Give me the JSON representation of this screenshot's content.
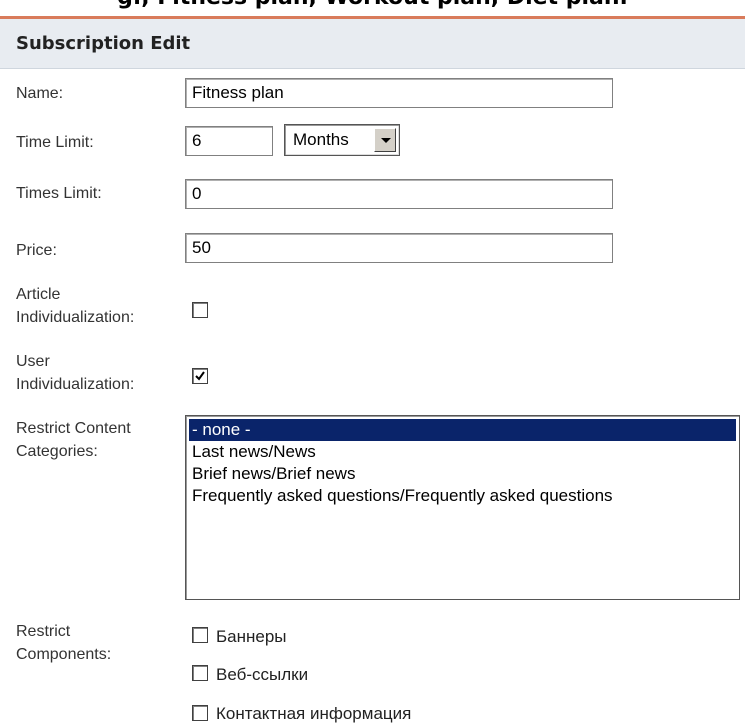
{
  "top_heading": "g., Fitness plan, Workout plan, Diet plan.",
  "panel": {
    "title": "Subscription Edit"
  },
  "form": {
    "name": {
      "label": "Name:",
      "value": "Fitness plan"
    },
    "time_limit": {
      "label": "Time Limit:",
      "value": "6",
      "unit_selected": "Months"
    },
    "times_limit": {
      "label": "Times Limit:",
      "value": "0"
    },
    "price": {
      "label": "Price:",
      "value": "50"
    },
    "article_individualization": {
      "label_line1": "Article",
      "label_line2": "Individualization:",
      "checked": false
    },
    "user_individualization": {
      "label_line1": "User",
      "label_line2": "Individualization:",
      "checked": true
    },
    "restrict_categories": {
      "label_line1": "Restrict Content",
      "label_line2": "Categories:",
      "options": [
        {
          "label": "- none -",
          "selected": true
        },
        {
          "label": "Last news/News",
          "selected": false
        },
        {
          "label": "Brief news/Brief news",
          "selected": false
        },
        {
          "label": "Frequently asked questions/Frequently asked questions",
          "selected": false
        }
      ]
    },
    "restrict_components": {
      "label_line1": "Restrict",
      "label_line2": "Components:",
      "items": [
        {
          "label": "Баннеры",
          "checked": false
        },
        {
          "label": "Веб-ссылки",
          "checked": false
        },
        {
          "label": "Контактная информация",
          "checked": false
        }
      ]
    }
  },
  "colors": {
    "accent_line": "#d97b5b",
    "header_bg": "#e8ecf1",
    "selection": "#0a246a"
  }
}
